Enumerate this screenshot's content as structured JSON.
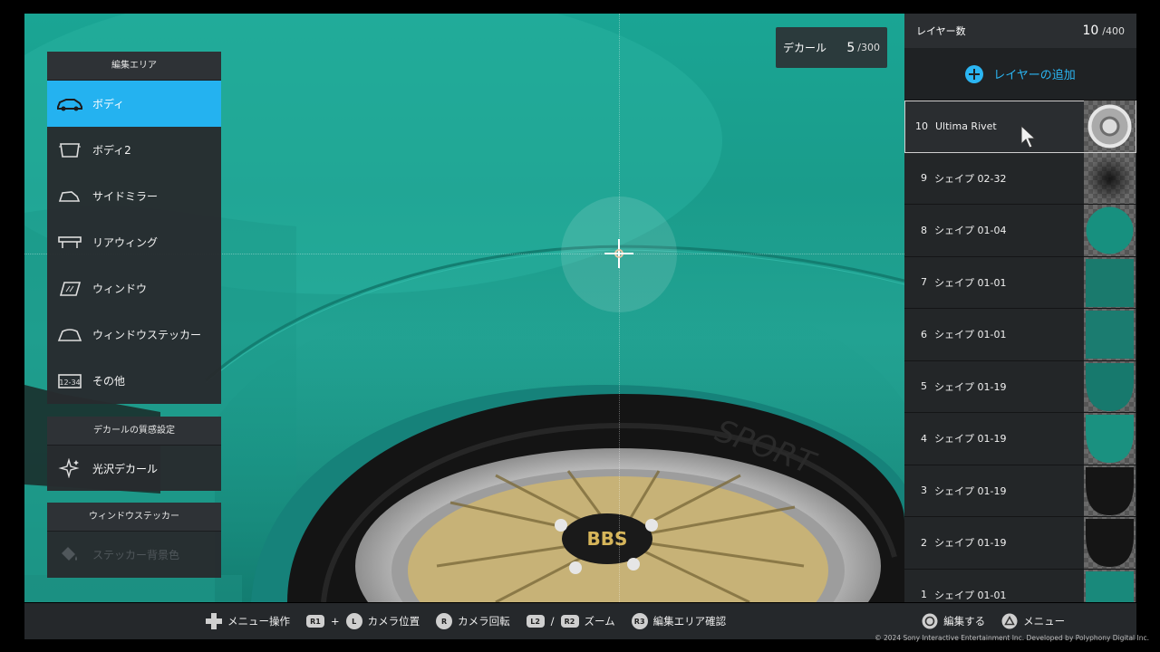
{
  "decal_counter": {
    "label": "デカール",
    "current": "5",
    "max": "/300"
  },
  "edit_area": {
    "title": "編集エリア",
    "items": [
      {
        "label": "ボディ",
        "icon": "car-body-icon",
        "active": true
      },
      {
        "label": "ボディ2",
        "icon": "car-body-2-icon"
      },
      {
        "label": "サイドミラー",
        "icon": "side-mirror-icon"
      },
      {
        "label": "リアウィング",
        "icon": "rear-wing-icon"
      },
      {
        "label": "ウィンドウ",
        "icon": "window-icon"
      },
      {
        "label": "ウィンドウステッカー",
        "icon": "window-sticker-icon"
      },
      {
        "label": "その他",
        "icon": "other-icon"
      }
    ]
  },
  "decal_material": {
    "title": "デカールの質感設定",
    "item": "光沢デカール",
    "icon": "sparkle-icon"
  },
  "window_sticker": {
    "title": "ウィンドウステッカー",
    "item": "ステッカー背景色",
    "icon": "paint-bucket-icon"
  },
  "layers": {
    "count_label": "レイヤー数",
    "count_current": "10",
    "count_max": "/400",
    "add_label": "レイヤーの追加",
    "rows": [
      {
        "num": "10",
        "name": "Ultima Rivet",
        "selected": true,
        "thumb": "rivet"
      },
      {
        "num": "9",
        "name": "シェイプ 02-32",
        "thumb": "blur"
      },
      {
        "num": "8",
        "name": "シェイプ 01-04",
        "thumb": "circle"
      },
      {
        "num": "7",
        "name": "シェイプ 01-01",
        "thumb": "square"
      },
      {
        "num": "6",
        "name": "シェイプ 01-01",
        "thumb": "square"
      },
      {
        "num": "5",
        "name": "シェイプ 01-19",
        "thumb": "half-teal"
      },
      {
        "num": "4",
        "name": "シェイプ 01-19",
        "thumb": "half-teal-light"
      },
      {
        "num": "3",
        "name": "シェイプ 01-19",
        "thumb": "half-black"
      },
      {
        "num": "2",
        "name": "シェイプ 01-19",
        "thumb": "half-black"
      },
      {
        "num": "1",
        "name": "シェイプ 01-01",
        "thumb": "square"
      }
    ]
  },
  "bottom_bar": {
    "menu_ops": "メニュー操作",
    "r1": "R1",
    "plus": "+",
    "l_stick": "L",
    "camera_pos": "カメラ位置",
    "r_stick": "R",
    "camera_rot": "カメラ回転",
    "l2": "L2",
    "slash": "/",
    "r2": "R2",
    "zoom": "ズーム",
    "r3": "R3",
    "edit_area_confirm": "編集エリア確認",
    "edit": "編集する",
    "menu": "メニュー"
  },
  "tire_text": "SPORT",
  "wheel_logo": "BBS",
  "copyright": "© 2024 Sony Interactive Entertainment Inc. Developed by Polyphony Digital Inc.",
  "colors": {
    "accent": "#24b2f0",
    "body_paint": "#1aa594",
    "wheel_gold": "#d6c28a"
  }
}
